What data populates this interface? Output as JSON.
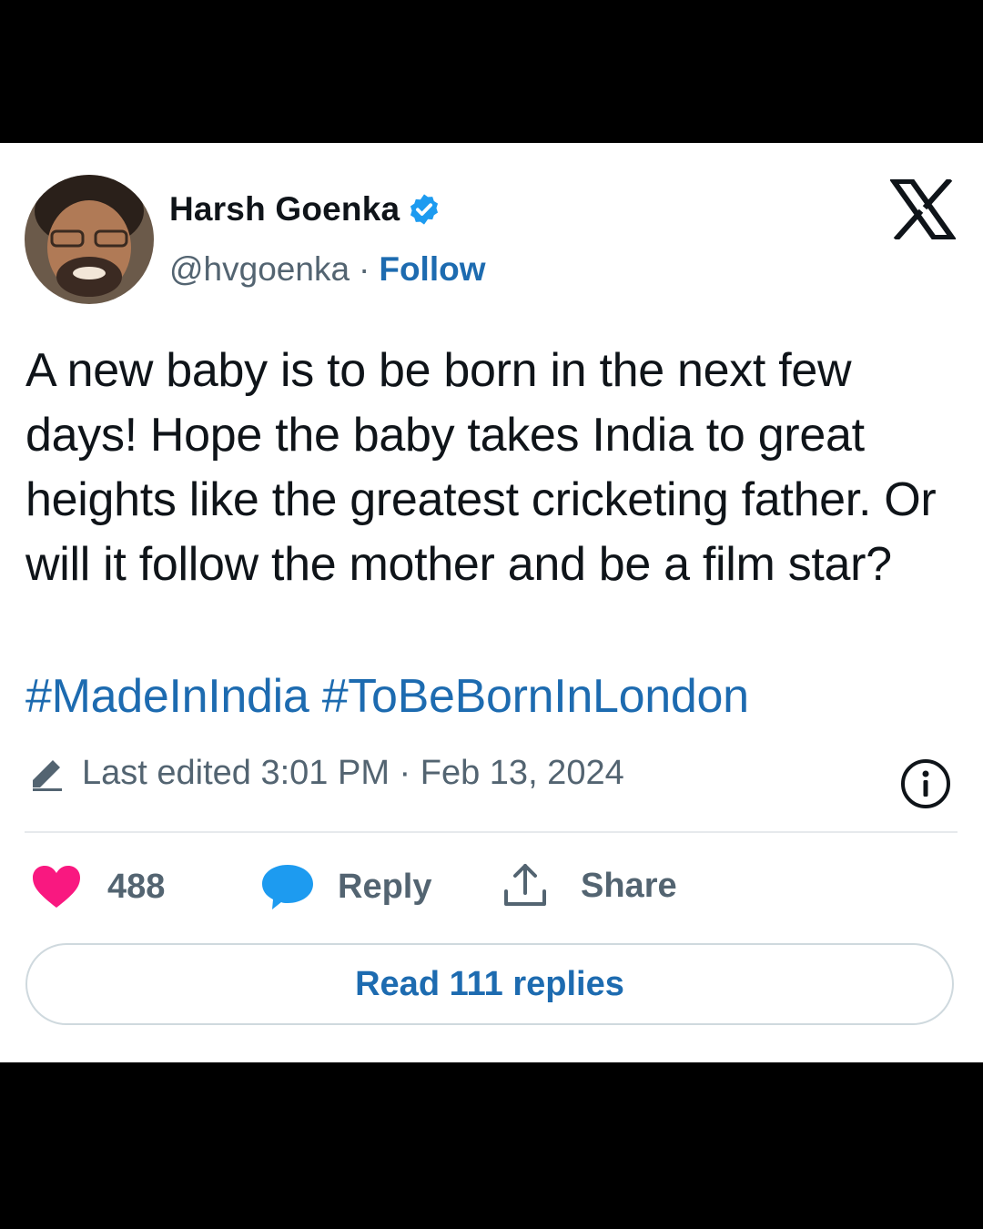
{
  "author": {
    "name": "Harsh Goenka",
    "handle": "@hvgoenka",
    "separator": "·",
    "follow_label": "Follow",
    "verified_icon": "verified-badge-icon"
  },
  "platform_logo": "x-logo-icon",
  "tweet": {
    "text": "A new baby is to be born in the next few days! Hope the baby takes India to great heights like the greatest cricketing father. Or will it follow the mother and be a film star?",
    "hashtags": [
      "#MadeInIndia",
      "#ToBeBornInLondon"
    ]
  },
  "meta": {
    "edited_text": "Last edited 3:01 PM · Feb 13, 2024"
  },
  "actions": {
    "like_count": "488",
    "reply_label": "Reply",
    "share_label": "Share"
  },
  "read_replies_label": "Read 111 replies",
  "colors": {
    "link": "#1d6bb0",
    "like": "#f91880",
    "reply": "#1d9bf0",
    "text": "#0f1419",
    "secondary": "#536471"
  }
}
